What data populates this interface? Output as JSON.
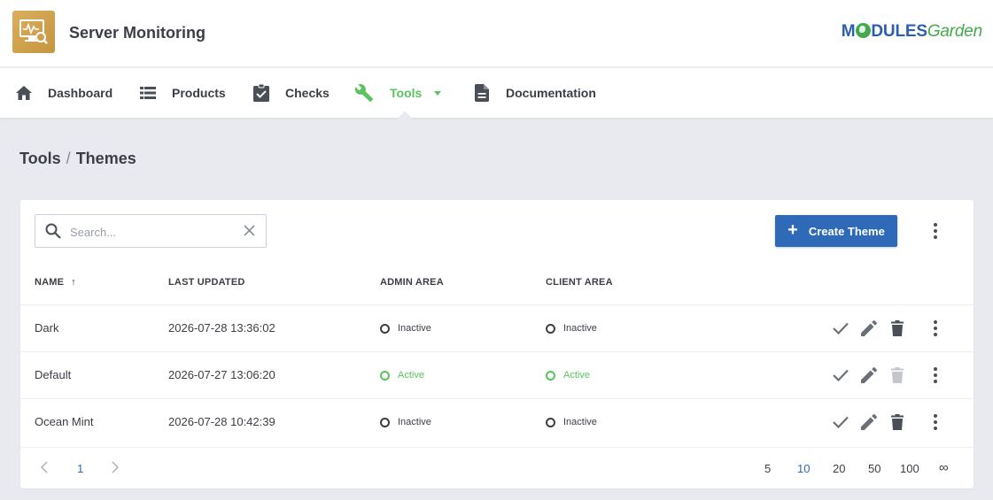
{
  "app": {
    "title": "Server Monitoring",
    "icon": "monitor-search-icon"
  },
  "logo": {
    "part1": "M",
    "part2": "DULES",
    "part3": "Garden"
  },
  "nav": {
    "items": [
      {
        "label": "Dashboard",
        "icon": "home-icon"
      },
      {
        "label": "Products",
        "icon": "list-icon"
      },
      {
        "label": "Checks",
        "icon": "clipboard-check-icon"
      },
      {
        "label": "Tools",
        "icon": "wrench-icon",
        "active": true
      },
      {
        "label": "Documentation",
        "icon": "document-icon"
      }
    ]
  },
  "breadcrumb": {
    "parent": "Tools",
    "separator": "/",
    "current": "Themes"
  },
  "toolbar": {
    "search_placeholder": "Search...",
    "create_label": "Create Theme"
  },
  "table": {
    "columns": {
      "name": "NAME",
      "sort_arrow": "↑",
      "last_updated": "LAST UPDATED",
      "admin_area": "ADMIN AREA",
      "client_area": "CLIENT AREA"
    },
    "rows": [
      {
        "name": "Dark",
        "last_updated": "2026-07-28 13:36:02",
        "admin_area": "Inactive",
        "client_area": "Inactive"
      },
      {
        "name": "Default",
        "last_updated": "2026-07-27 13:06:20",
        "admin_area": "Active",
        "client_area": "Active"
      },
      {
        "name": "Ocean Mint",
        "last_updated": "2026-07-28 10:42:39",
        "admin_area": "Inactive",
        "client_area": "Inactive"
      }
    ]
  },
  "pagination": {
    "current_page": "1",
    "page_sizes": [
      "5",
      "10",
      "20",
      "50",
      "100",
      "∞"
    ],
    "selected_page_size": "10"
  },
  "colors": {
    "accent_green": "#5ac35e",
    "primary_blue": "#2e6ab8",
    "brand_gold": "#d0a24f"
  }
}
